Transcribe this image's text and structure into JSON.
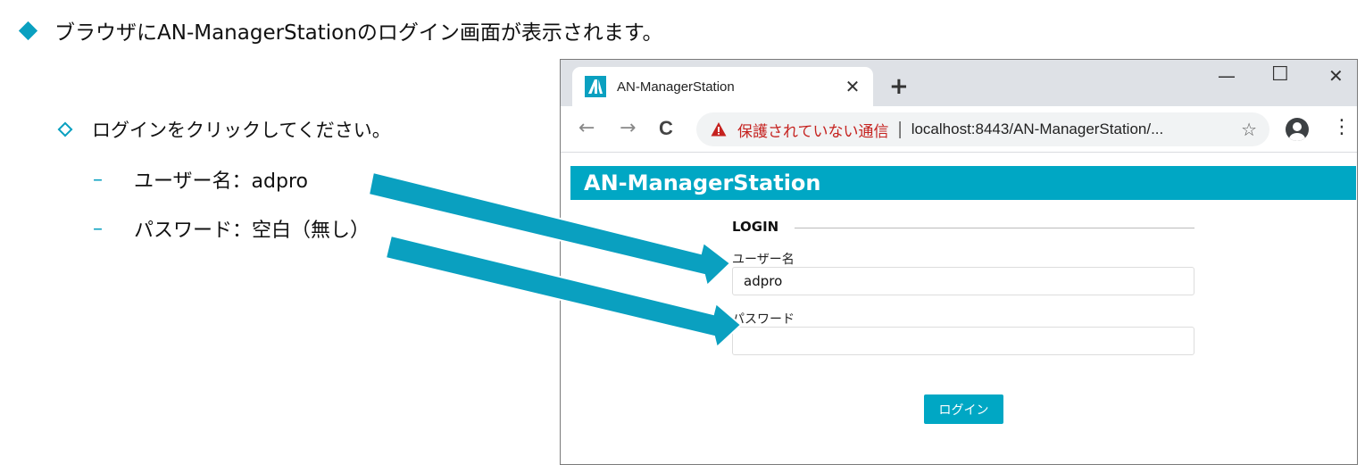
{
  "slide": {
    "main_bullet": "ブラウザにAN-ManagerStationのログイン画面が表示されます。",
    "sub_bullet": "ログインをクリックしてください。",
    "items": [
      {
        "dash": "–",
        "text": "ユーザー名：adpro"
      },
      {
        "dash": "–",
        "text": "パスワード：空白（無し）"
      }
    ]
  },
  "browser": {
    "tab_title": "AN-ManagerStation",
    "tab_close": "✕",
    "new_tab": "+",
    "window_controls": {
      "minimize": "—",
      "maximize": "☐",
      "close": "✕"
    },
    "nav": {
      "back": "←",
      "forward": "→",
      "reload": "C"
    },
    "security_warning": "保護されていない通信",
    "separator": "|",
    "url": "localhost:8443/AN-ManagerStation/...",
    "bookmark_icon": "☆",
    "menu_icon": "⋮"
  },
  "app": {
    "header_title": "AN-ManagerStation",
    "login_title": "LOGIN",
    "username_label": "ユーザー名",
    "username_value": "adpro",
    "password_label": "パスワード",
    "password_value": "",
    "login_button": "ログイン"
  },
  "colors": {
    "accent": "#00a7c4",
    "warning": "#c5221f",
    "tab_bar": "#dee1e6"
  },
  "icons": [
    "diamond-filled-bullet",
    "diamond-hollow-bullet",
    "app-favicon",
    "warning-icon",
    "star-icon",
    "profile-icon",
    "menu-icon",
    "arrow-pointer"
  ]
}
